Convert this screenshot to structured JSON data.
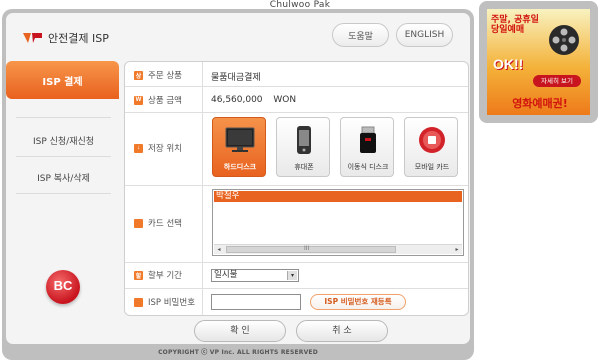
{
  "top_caption": "Chulwoo Pak",
  "header": {
    "title": "안전결제 ISP",
    "help_label": "도움말",
    "english_label": "ENGLISH"
  },
  "sidebar": {
    "active_label": "ISP 결제",
    "items": [
      {
        "label": "ISP 신청/재신청"
      },
      {
        "label": "ISP 복사/삭제"
      }
    ],
    "brand_logo_text": "BC"
  },
  "form": {
    "product": {
      "label": "주문 상품",
      "icon_text": "상",
      "value": "물품대금결제"
    },
    "amount": {
      "label": "상품 금액",
      "icon_text": "W",
      "value": "46,560,000",
      "unit": "WON"
    },
    "storage": {
      "label": "저장 위치",
      "icon_text": "↓",
      "devices": [
        {
          "label": "하드디스크",
          "selected": true
        },
        {
          "label": "휴대폰",
          "selected": false
        },
        {
          "label": "이동식 디스크",
          "selected": false
        },
        {
          "label": "모바일 카드",
          "selected": false
        }
      ]
    },
    "card": {
      "label": "카드 선택",
      "icon_text": "",
      "selected_card": "박철우",
      "scroll_left": "◂",
      "scroll_right": "▸",
      "scroll_grip": "III"
    },
    "installment": {
      "label": "할부 기간",
      "icon_text": "할",
      "value": "일시불",
      "arrow": "▾"
    },
    "password": {
      "label": "ISP 비밀번호",
      "icon_text": "🔒",
      "value": "",
      "reregister_label": "ISP 비밀번호 재등록"
    }
  },
  "buttons": {
    "confirm_label": "확 인",
    "cancel_label": "취 소"
  },
  "copyright": "COPYRIGHT ⓒ VP Inc. ALL RIGHTS RESERVED",
  "ad": {
    "line1": "주말, 공휴일",
    "line2": "당일예매",
    "ok_text": "OK!!",
    "more_label": "자세히 보기",
    "bottom_text": "영화예매권!"
  },
  "colors": {
    "accent": "#e8631f",
    "brand_red": "#c8141e"
  }
}
